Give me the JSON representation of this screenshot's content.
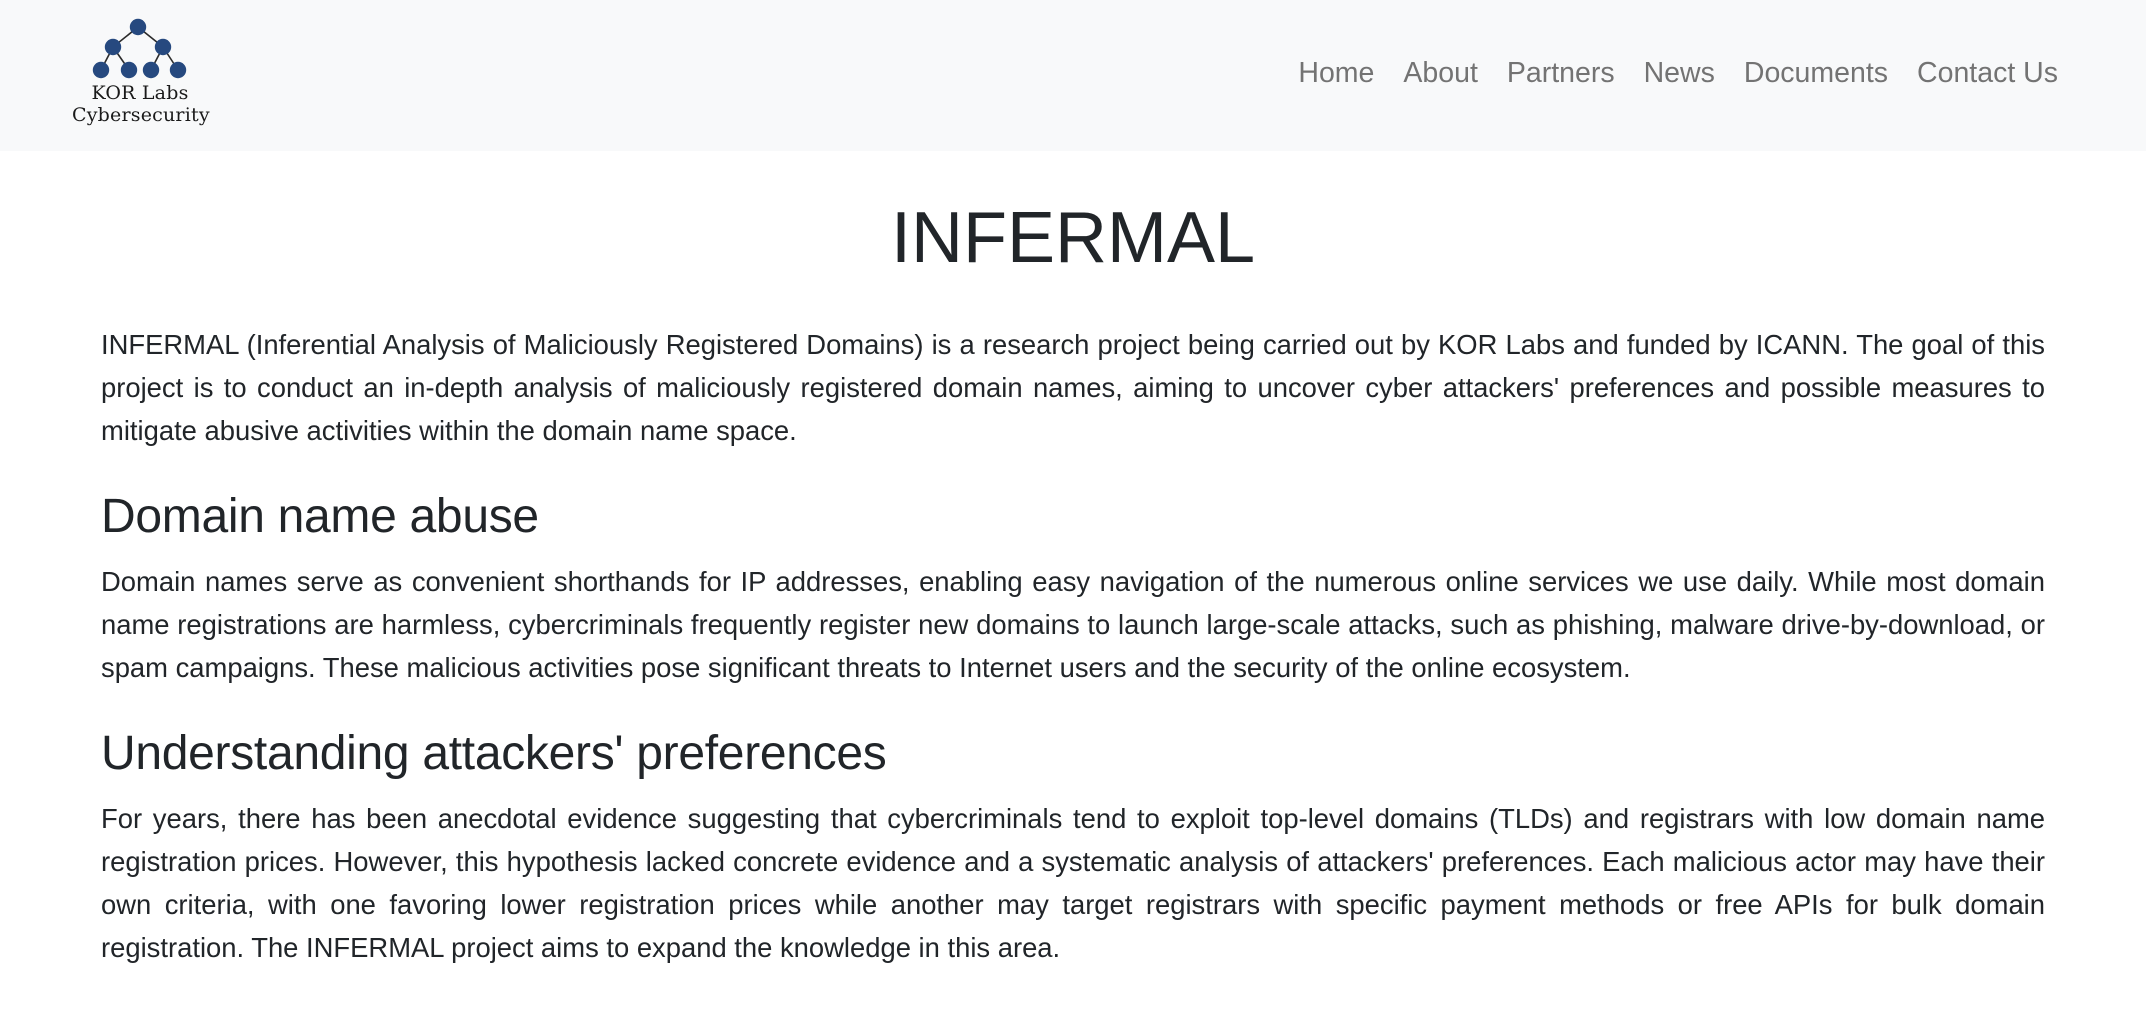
{
  "navbar": {
    "brand": {
      "logo_icon": "network-tree-icon",
      "line1": "KOR Labs",
      "line2": "Cybersecurity",
      "logo_color": "#26497f"
    },
    "links": [
      {
        "label": "Home"
      },
      {
        "label": "About"
      },
      {
        "label": "Partners"
      },
      {
        "label": "News"
      },
      {
        "label": "Documents"
      },
      {
        "label": "Contact Us"
      }
    ]
  },
  "main": {
    "title": "INFERMAL",
    "intro": "INFERMAL (Inferential Analysis of Maliciously Registered Domains) is a research project being carried out by KOR Labs and funded by ICANN. The goal of this project is to conduct an in-depth analysis of maliciously registered domain names, aiming to uncover cyber attackers' preferences and possible measures to mitigate abusive activities within the domain name space.",
    "sections": [
      {
        "heading": "Domain name abuse",
        "body": "Domain names serve as convenient shorthands for IP addresses, enabling easy navigation of the numerous online services we use daily. While most domain name registrations are harmless, cybercriminals frequently register new domains to launch large-scale attacks, such as phishing, malware drive-by-download, or spam campaigns. These malicious activities pose significant threats to Internet users and the security of the online ecosystem."
      },
      {
        "heading": "Understanding attackers' preferences",
        "body": "For years, there has been anecdotal evidence suggesting that cybercriminals tend to exploit top-level domains (TLDs) and registrars with low domain name registration prices. However, this hypothesis lacked concrete evidence and a systematic analysis of attackers' preferences. Each malicious actor may have their own criteria, with one favoring lower registration prices while another may target registrars with specific payment methods or free APIs for bulk domain registration. The INFERMAL project aims to expand the knowledge in this area."
      }
    ]
  }
}
